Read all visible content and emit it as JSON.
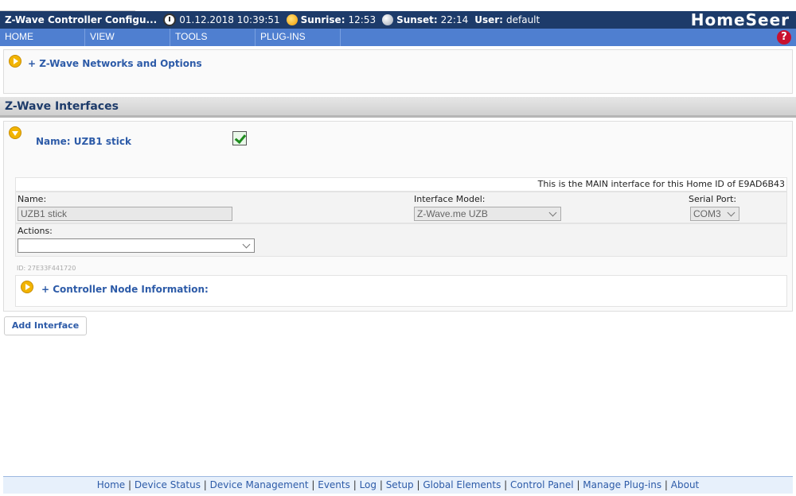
{
  "header": {
    "title": "Z-Wave Controller Configu...",
    "date_time": "01.12.2018 10:39:51",
    "sunrise_label": "Sunrise:",
    "sunrise_value": "12:53",
    "sunset_label": "Sunset:",
    "sunset_value": "22:14",
    "user_label": "User:",
    "user_value": "default",
    "logo": "HomeSeer"
  },
  "menu": {
    "items": [
      "HOME",
      "VIEW",
      "TOOLS",
      "PLUG-INS"
    ],
    "help_icon": "?"
  },
  "networks": {
    "label": "+ Z-Wave Networks and Options"
  },
  "section": {
    "title": "Z-Wave Interfaces"
  },
  "interface": {
    "name_label": "Name: UZB1 stick",
    "enabled": true,
    "main_info": "This is the MAIN interface for this Home ID of E9AD6B43",
    "fields": {
      "name_label": "Name:",
      "name_value": "UZB1 stick",
      "model_label": "Interface Model:",
      "model_value": "Z-Wave.me UZB",
      "port_label": "Serial Port:",
      "port_value": "COM3",
      "actions_label": "Actions:",
      "actions_value": ""
    },
    "id_text": "ID: 27E33F441720",
    "controller_node_label": "+ Controller Node Information:"
  },
  "add_button": "Add Interface",
  "footer": {
    "links": [
      "Home",
      "Device Status",
      "Device Management",
      "Events",
      "Log",
      "Setup",
      "Global Elements",
      "Control Panel",
      "Manage Plug-ins",
      "About"
    ]
  },
  "colors": {
    "titlebar": "#1d3b6a",
    "menubar": "#4f7fd0",
    "link": "#2d5ba8",
    "accent": "#f2b400"
  }
}
